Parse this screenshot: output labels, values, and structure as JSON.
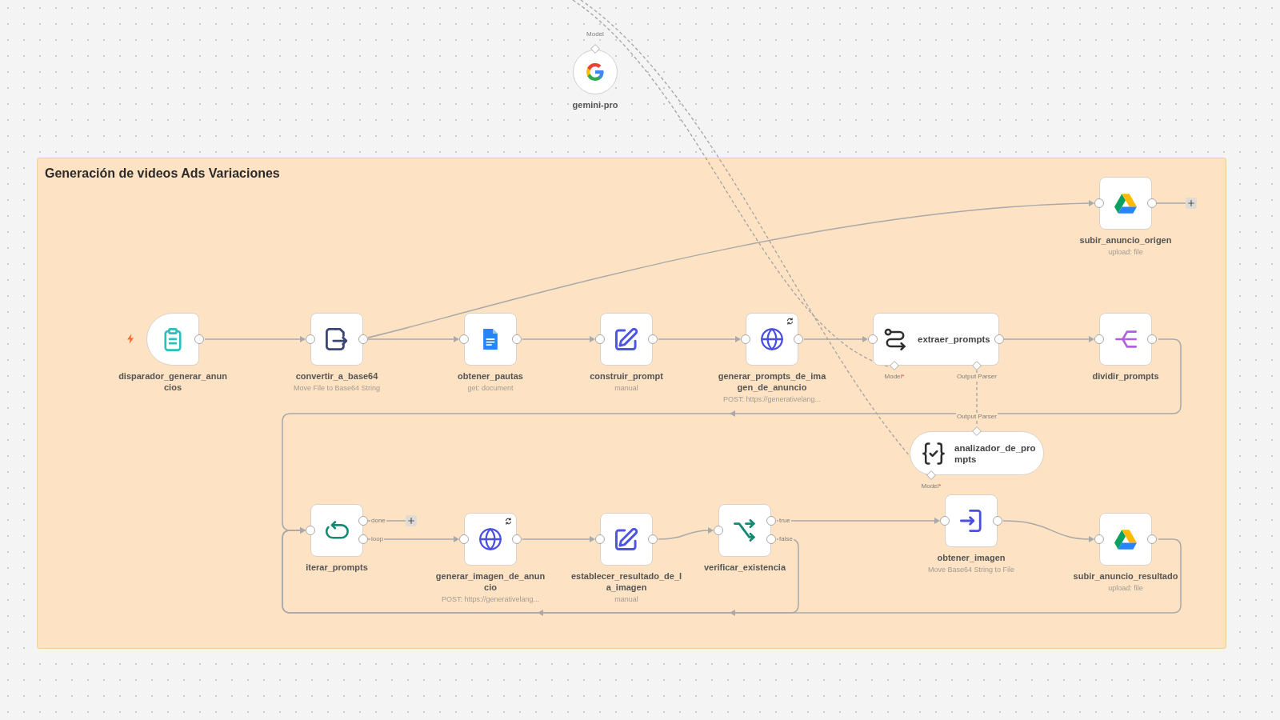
{
  "sticky_note": {
    "title": "Generación de videos Ads Variaciones"
  },
  "nodes": [
    {
      "kind": "lm",
      "title": "gemini-pro",
      "sync_badge": false,
      "ports": [
        {
          "label": "Model"
        }
      ]
    },
    {
      "kind": "drive",
      "title": "subir_anuncio_origen",
      "subtitle": "upload: file",
      "sync_badge": false,
      "outputs": [
        {
          "connected": false
        }
      ]
    },
    {
      "kind": "trigger",
      "title": "disparador_generar_anuncios",
      "sync_badge": false,
      "outputs": [
        {
          "connected": true
        }
      ]
    },
    {
      "kind": "to_base64",
      "title": "convertir_a_base64",
      "subtitle": "Move File to Base64 String",
      "sync_badge": false,
      "outputs": [
        {
          "connected": true
        }
      ]
    },
    {
      "kind": "docs",
      "title": "obtener_pautas",
      "subtitle": "get: document",
      "sync_badge": false,
      "outputs": [
        {
          "connected": true
        }
      ]
    },
    {
      "kind": "set",
      "title": "construir_prompt",
      "subtitle": "manual",
      "sync_badge": false,
      "outputs": [
        {
          "connected": true
        }
      ]
    },
    {
      "kind": "http",
      "title": "generar_prompts_de_imagen_de_anuncio",
      "subtitle": "POST: https://generativelang...",
      "sync_badge": true,
      "outputs": [
        {
          "connected": true
        }
      ]
    },
    {
      "kind": "chain",
      "title": "extraer_prompts",
      "sync_badge": false,
      "outputs": [
        {
          "connected": true
        }
      ],
      "ports": [
        {
          "label": "Model",
          "mark": "*"
        },
        {
          "label": "Output Parser"
        }
      ]
    },
    {
      "kind": "split",
      "title": "dividir_prompts",
      "sync_badge": false,
      "outputs": [
        {
          "connected": true
        }
      ]
    },
    {
      "kind": "parser",
      "title": "analizador_de_prompts",
      "sync_badge": false,
      "ports": [
        {
          "label": "Output Parser"
        },
        {
          "label": "Model",
          "mark": "*"
        }
      ]
    },
    {
      "kind": "loop",
      "title": "iterar_prompts",
      "sync_badge": false,
      "outputs": [
        {
          "label": "done",
          "connected": false
        },
        {
          "label": "loop",
          "connected": true
        }
      ]
    },
    {
      "kind": "http",
      "title": "generar_imagen_de_anuncio",
      "subtitle": "POST: https://generativelang...",
      "sync_badge": true,
      "outputs": [
        {
          "connected": true
        }
      ]
    },
    {
      "kind": "set",
      "title": "establecer_resultado_de_la_imagen",
      "subtitle": "manual",
      "sync_badge": false,
      "outputs": [
        {
          "connected": true
        }
      ]
    },
    {
      "kind": "if",
      "title": "verificar_existencia",
      "sync_badge": false,
      "outputs": [
        {
          "label": "true",
          "connected": true
        },
        {
          "label": "false",
          "connected": true
        }
      ]
    },
    {
      "kind": "from_base64",
      "title": "obtener_imagen",
      "subtitle": "Move Base64 String to File",
      "sync_badge": false,
      "outputs": [
        {
          "connected": true
        }
      ]
    },
    {
      "kind": "drive",
      "title": "subir_anuncio_resultado",
      "subtitle": "upload: file",
      "sync_badge": false,
      "outputs": [
        {
          "connected": true
        }
      ]
    }
  ]
}
